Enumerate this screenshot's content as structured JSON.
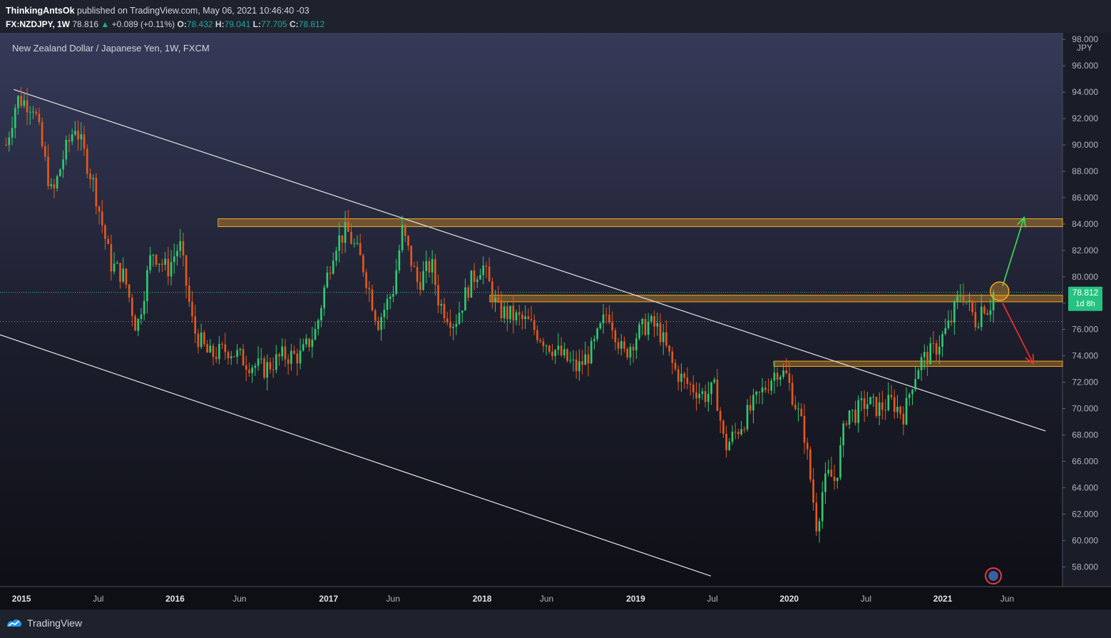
{
  "header": {
    "author": "ThinkingAntsOk",
    "published_text": "published on TradingView.com, May 06, 2021 10:46:40 -03",
    "symbol": "FX:NZDJPY, 1W",
    "last": "78.816",
    "change": "+0.089 (+0.11%)",
    "open_label": "O:",
    "open": "78.432",
    "high_label": "H:",
    "high": "79.041",
    "low_label": "L:",
    "low": "77.705",
    "close_label": "C:",
    "close": "78.812"
  },
  "chart_data": {
    "type": "candlestick",
    "title": "New Zealand Dollar / Japanese Yen, 1W, FXCM",
    "currency_label": "JPY",
    "y_axis": {
      "ticks": [
        "58.000",
        "60.000",
        "62.000",
        "64.000",
        "66.000",
        "68.000",
        "70.000",
        "72.000",
        "74.000",
        "76.000",
        "78.000",
        "80.000",
        "82.000",
        "84.000",
        "86.000",
        "88.000",
        "90.000",
        "92.000",
        "94.000",
        "96.000",
        "98.000"
      ],
      "ylim": [
        56.5,
        98.5
      ]
    },
    "x_axis": {
      "labels": [
        "2015",
        "Jul",
        "2016",
        "Jun",
        "2017",
        "Jun",
        "2018",
        "Jun",
        "2019",
        "Jul",
        "2020",
        "Jul",
        "2021",
        "Jun"
      ],
      "label_dates": [
        2015.0,
        2015.5,
        2016.0,
        2016.42,
        2017.0,
        2017.42,
        2018.0,
        2018.42,
        2019.0,
        2019.5,
        2020.0,
        2020.5,
        2021.0,
        2021.42
      ],
      "xlim": [
        2014.86,
        2021.78
      ]
    },
    "price_path_dates": [
      2014.9,
      2014.97,
      2015.08,
      2015.2,
      2015.27,
      2015.35,
      2015.47,
      2015.58,
      2015.67,
      2015.75,
      2015.85,
      2015.95,
      2016.03,
      2016.12,
      2016.22,
      2016.35,
      2016.47,
      2016.58,
      2016.7,
      2016.82,
      2016.92,
      2016.97,
      2017.04,
      2017.12,
      2017.22,
      2017.32,
      2017.42,
      2017.48,
      2017.58,
      2017.67,
      2017.72,
      2017.82,
      2017.92,
      2018.0,
      2018.1,
      2018.2,
      2018.3,
      2018.42,
      2018.52,
      2018.62,
      2018.72,
      2018.82,
      2018.92,
      2019.0,
      2019.08,
      2019.15,
      2019.25,
      2019.32,
      2019.45,
      2019.52,
      2019.58,
      2019.67,
      2019.78,
      2019.92,
      2019.98,
      2020.05,
      2020.1,
      2020.18,
      2020.22,
      2020.26,
      2020.3,
      2020.38,
      2020.42,
      2020.5,
      2020.58,
      2020.67,
      2020.75,
      2020.8,
      2020.85,
      2020.95,
      2021.05,
      2021.12,
      2021.16,
      2021.22,
      2021.26,
      2021.3,
      2021.33
    ],
    "price_path_values": [
      90,
      93.5,
      93,
      86,
      89,
      91.5,
      87,
      81,
      80,
      76,
      82,
      80.5,
      82.5,
      76,
      74,
      74.5,
      73.5,
      73,
      74,
      74,
      76,
      79,
      82.5,
      83.5,
      81,
      76.5,
      79,
      83.5,
      79.5,
      81,
      78,
      76.5,
      79.5,
      81,
      77.5,
      77,
      76.5,
      75,
      74,
      73,
      74.5,
      77.5,
      74,
      75.5,
      76.5,
      76,
      73,
      72,
      71,
      71.5,
      67,
      68.5,
      70.5,
      73,
      72.5,
      70,
      68,
      61,
      64,
      65,
      64.5,
      70,
      69.5,
      70.5,
      70,
      70.5,
      69.5,
      72,
      73.5,
      74.5,
      76.5,
      79,
      78,
      76.5,
      78,
      77.5,
      78.8
    ],
    "current_price": "78.812",
    "countdown": "1d 8h",
    "prev_close_price": 76.6,
    "zones": [
      {
        "from": 2016.28,
        "to": 2021.78,
        "low": 83.8,
        "high": 84.4
      },
      {
        "from": 2018.05,
        "to": 2021.78,
        "low": 78.1,
        "high": 78.6
      },
      {
        "from": 2019.9,
        "to": 2021.78,
        "low": 73.2,
        "high": 73.6
      }
    ],
    "trend_lines": [
      {
        "x1": 2014.95,
        "y1": 94.2,
        "x2": 2021.67,
        "y2": 68.3
      },
      {
        "x1": 2014.86,
        "y1": 75.6,
        "x2": 2019.49,
        "y2": 57.3
      }
    ],
    "projection_up": {
      "x1": 2021.39,
      "y1": 79.3,
      "x2": 2021.53,
      "y2": 84.5
    },
    "projection_down": {
      "x1": 2021.39,
      "y1": 78.0,
      "x2": 2021.59,
      "y2": 73.4
    },
    "highlight_circle": {
      "x": 2021.37,
      "y": 78.9
    },
    "colors": {
      "up": "#26a69a",
      "up_body": "#2ecc71",
      "down": "#f7525f",
      "down_body": "#e8591a",
      "zone": "#f5a623",
      "price_badge": "#26c281"
    }
  },
  "footer": {
    "brand": "TradingView"
  }
}
